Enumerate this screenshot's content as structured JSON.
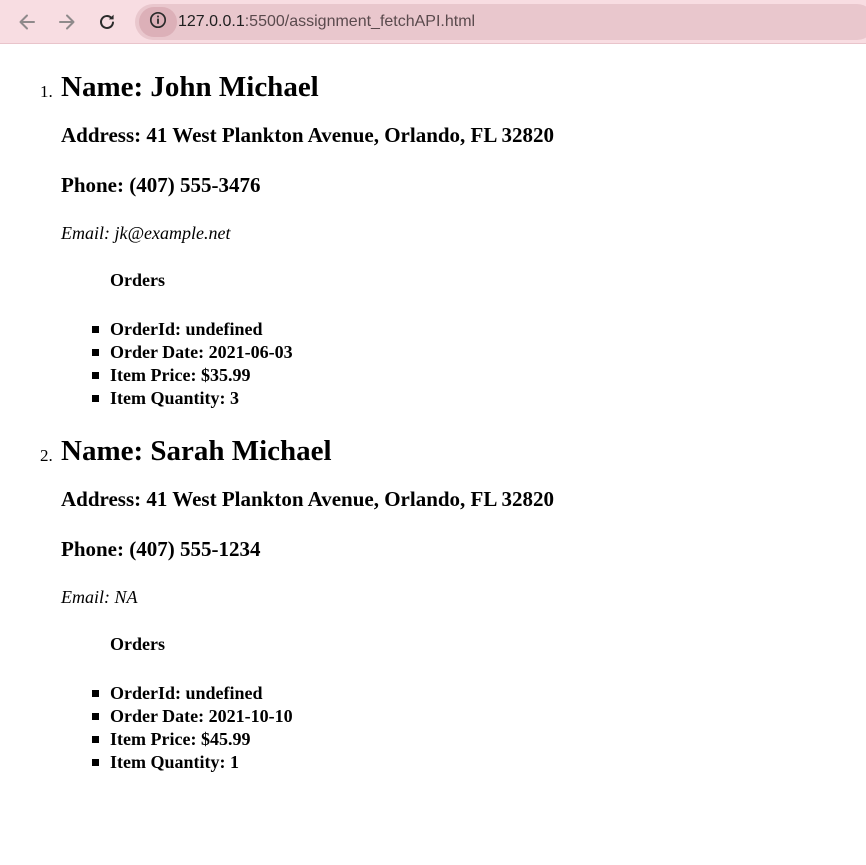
{
  "browser": {
    "url_host": "127.0.0.1",
    "url_rest": ":5500/assignment_fetchAPI.html",
    "icons": {
      "back": "arrow-left-icon",
      "forward": "arrow-right-icon",
      "reload": "reload-icon",
      "site_info": "info-circle-icon"
    },
    "colors": {
      "toolbar_bg": "#f8dde2",
      "address_bg": "#e9c7cd"
    }
  },
  "customers": [
    {
      "index": "1.",
      "name": "Name: John Michael",
      "address": "Address: 41 West Plankton Avenue, Orlando, FL 32820",
      "phone": "Phone: (407) 555-3476",
      "email": "Email: jk@example.net",
      "orders_title": "Orders",
      "orders": [
        "OrderId: undefined",
        "Order Date: 2021-06-03",
        "Item Price: $35.99",
        "Item Quantity: 3"
      ]
    },
    {
      "index": "2.",
      "name": "Name: Sarah Michael",
      "address": "Address: 41 West Plankton Avenue, Orlando, FL 32820",
      "phone": "Phone: (407) 555-1234",
      "email": "Email: NA",
      "orders_title": "Orders",
      "orders": [
        "OrderId: undefined",
        "Order Date: 2021-10-10",
        "Item Price: $45.99",
        "Item Quantity: 1"
      ]
    }
  ]
}
